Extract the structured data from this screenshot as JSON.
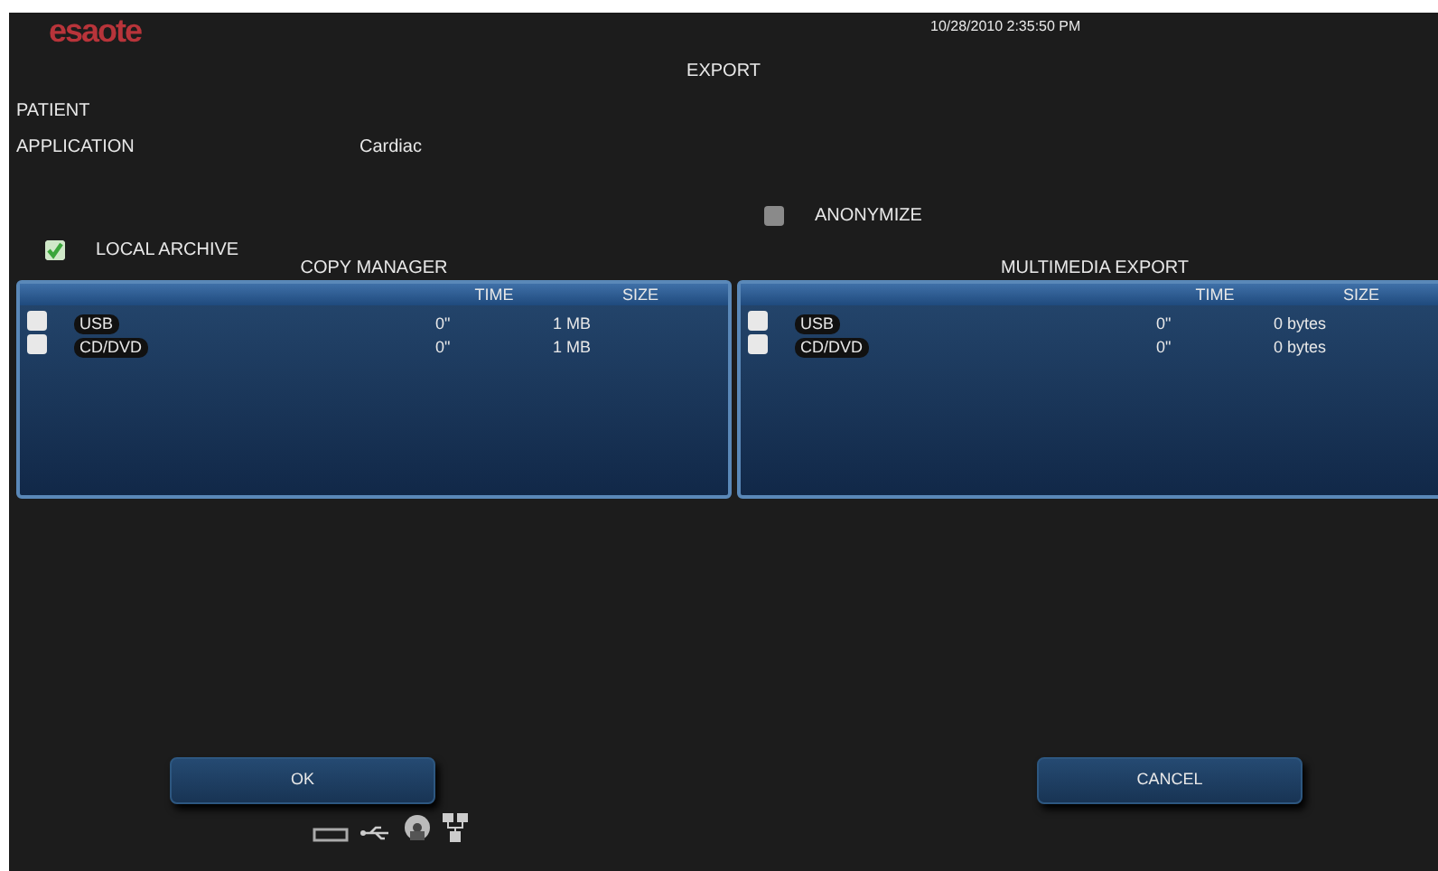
{
  "logo": "esaote",
  "datetime": "10/28/2010 2:35:50 PM",
  "title": "EXPORT",
  "fields": [
    {
      "label": "PATIENT"
    },
    {
      "label": "APPLICATION",
      "value": "Cardiac"
    }
  ],
  "anonymize": {
    "label": "ANONYMIZE",
    "checked": false
  },
  "local_archive": {
    "label": "LOCAL ARCHIVE",
    "checked": true
  },
  "panels": [
    {
      "title": "COPY MANAGER",
      "columns": [
        "TIME",
        "SIZE"
      ],
      "rows": [
        {
          "name": "USB",
          "time": "0\"",
          "size": "1 MB",
          "checked": false
        },
        {
          "name": "CD/DVD",
          "time": "0\"",
          "size": "1 MB",
          "checked": false
        }
      ]
    },
    {
      "title": "MULTIMEDIA EXPORT",
      "columns": [
        "TIME",
        "SIZE"
      ],
      "rows": [
        {
          "name": "USB",
          "time": "0\"",
          "size": "0 bytes",
          "checked": false
        },
        {
          "name": "CD/DVD",
          "time": "0\"",
          "size": "0 bytes",
          "checked": false
        }
      ]
    }
  ],
  "buttons": [
    "OK",
    "CANCEL"
  ]
}
